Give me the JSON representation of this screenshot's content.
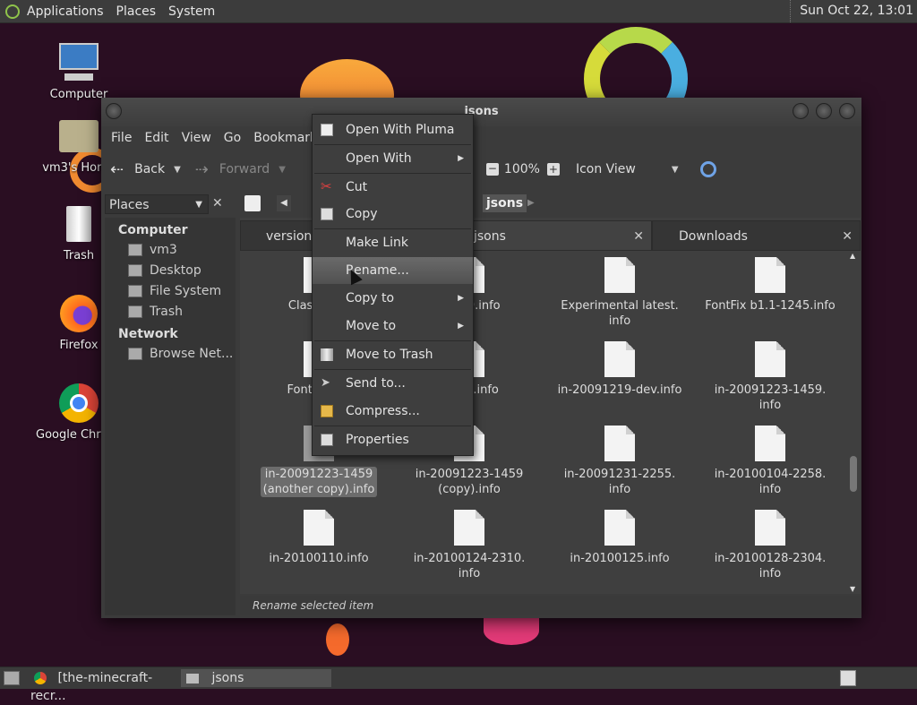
{
  "top_panel": {
    "menus": [
      "Applications",
      "Places",
      "System"
    ],
    "clock": "Sun Oct 22, 13:01"
  },
  "desktop_icons": [
    {
      "label": "Computer",
      "icon": "computer-icon"
    },
    {
      "label": "vm3's Home",
      "icon": "home-folder-icon"
    },
    {
      "label": "Trash",
      "icon": "trash-icon"
    },
    {
      "label": "Firefox",
      "icon": "firefox-icon"
    },
    {
      "label": "Google Chrome",
      "icon": "chrome-icon"
    }
  ],
  "window": {
    "title": "jsons",
    "menus": [
      "File",
      "Edit",
      "View",
      "Go",
      "Bookmarks"
    ],
    "toolbar": {
      "back": "Back",
      "forward": "Forward",
      "zoom": "100%",
      "view_mode": "Icon View"
    },
    "sidebar": {
      "combo": "Places",
      "sections": [
        {
          "heading": "Computer",
          "items": [
            "vm3",
            "Desktop",
            "File System",
            "Trash"
          ]
        },
        {
          "heading": "Network",
          "items": [
            "Browse Net..."
          ]
        }
      ]
    },
    "path": {
      "current": "jsons"
    },
    "tabs": [
      "versions",
      "jsons",
      "Downloads"
    ],
    "files": [
      "Classic+...",
      "...v1.9.info",
      "Experimental latest.\ninfo",
      "FontFix b1.1-1245.info",
      "FontFix b...",
      "...207.info",
      "in-20091219-dev.info",
      "in-20091223-1459.\ninfo",
      "in-20091223-1459\n(another copy).info",
      "in-20091223-1459\n(copy).info",
      "in-20091231-2255.\ninfo",
      "in-20100104-2258.\ninfo",
      "in-20100110.info",
      "in-20100124-2310.\ninfo",
      "in-20100125.info",
      "in-20100128-2304.\ninfo"
    ],
    "status": "Rename selected item"
  },
  "context_menu": [
    {
      "label": "Open With Pluma",
      "icon": "pluma-icon"
    },
    {
      "label": "Open With",
      "submenu": true
    },
    {
      "label": "Cut",
      "icon": "scissors-icon"
    },
    {
      "label": "Copy",
      "icon": "copy-icon"
    },
    {
      "label": "Make Link"
    },
    {
      "label": "Rename..."
    },
    {
      "label": "Copy to",
      "submenu": true
    },
    {
      "label": "Move to",
      "submenu": true
    },
    {
      "label": "Move to Trash",
      "icon": "trash-icon"
    },
    {
      "label": "Send to...",
      "icon": "send-icon"
    },
    {
      "label": "Compress...",
      "icon": "archive-icon"
    },
    {
      "label": "Properties",
      "icon": "properties-icon"
    }
  ],
  "taskbar": {
    "tasks": [
      "[the-minecraft-recr...",
      "jsons"
    ]
  }
}
